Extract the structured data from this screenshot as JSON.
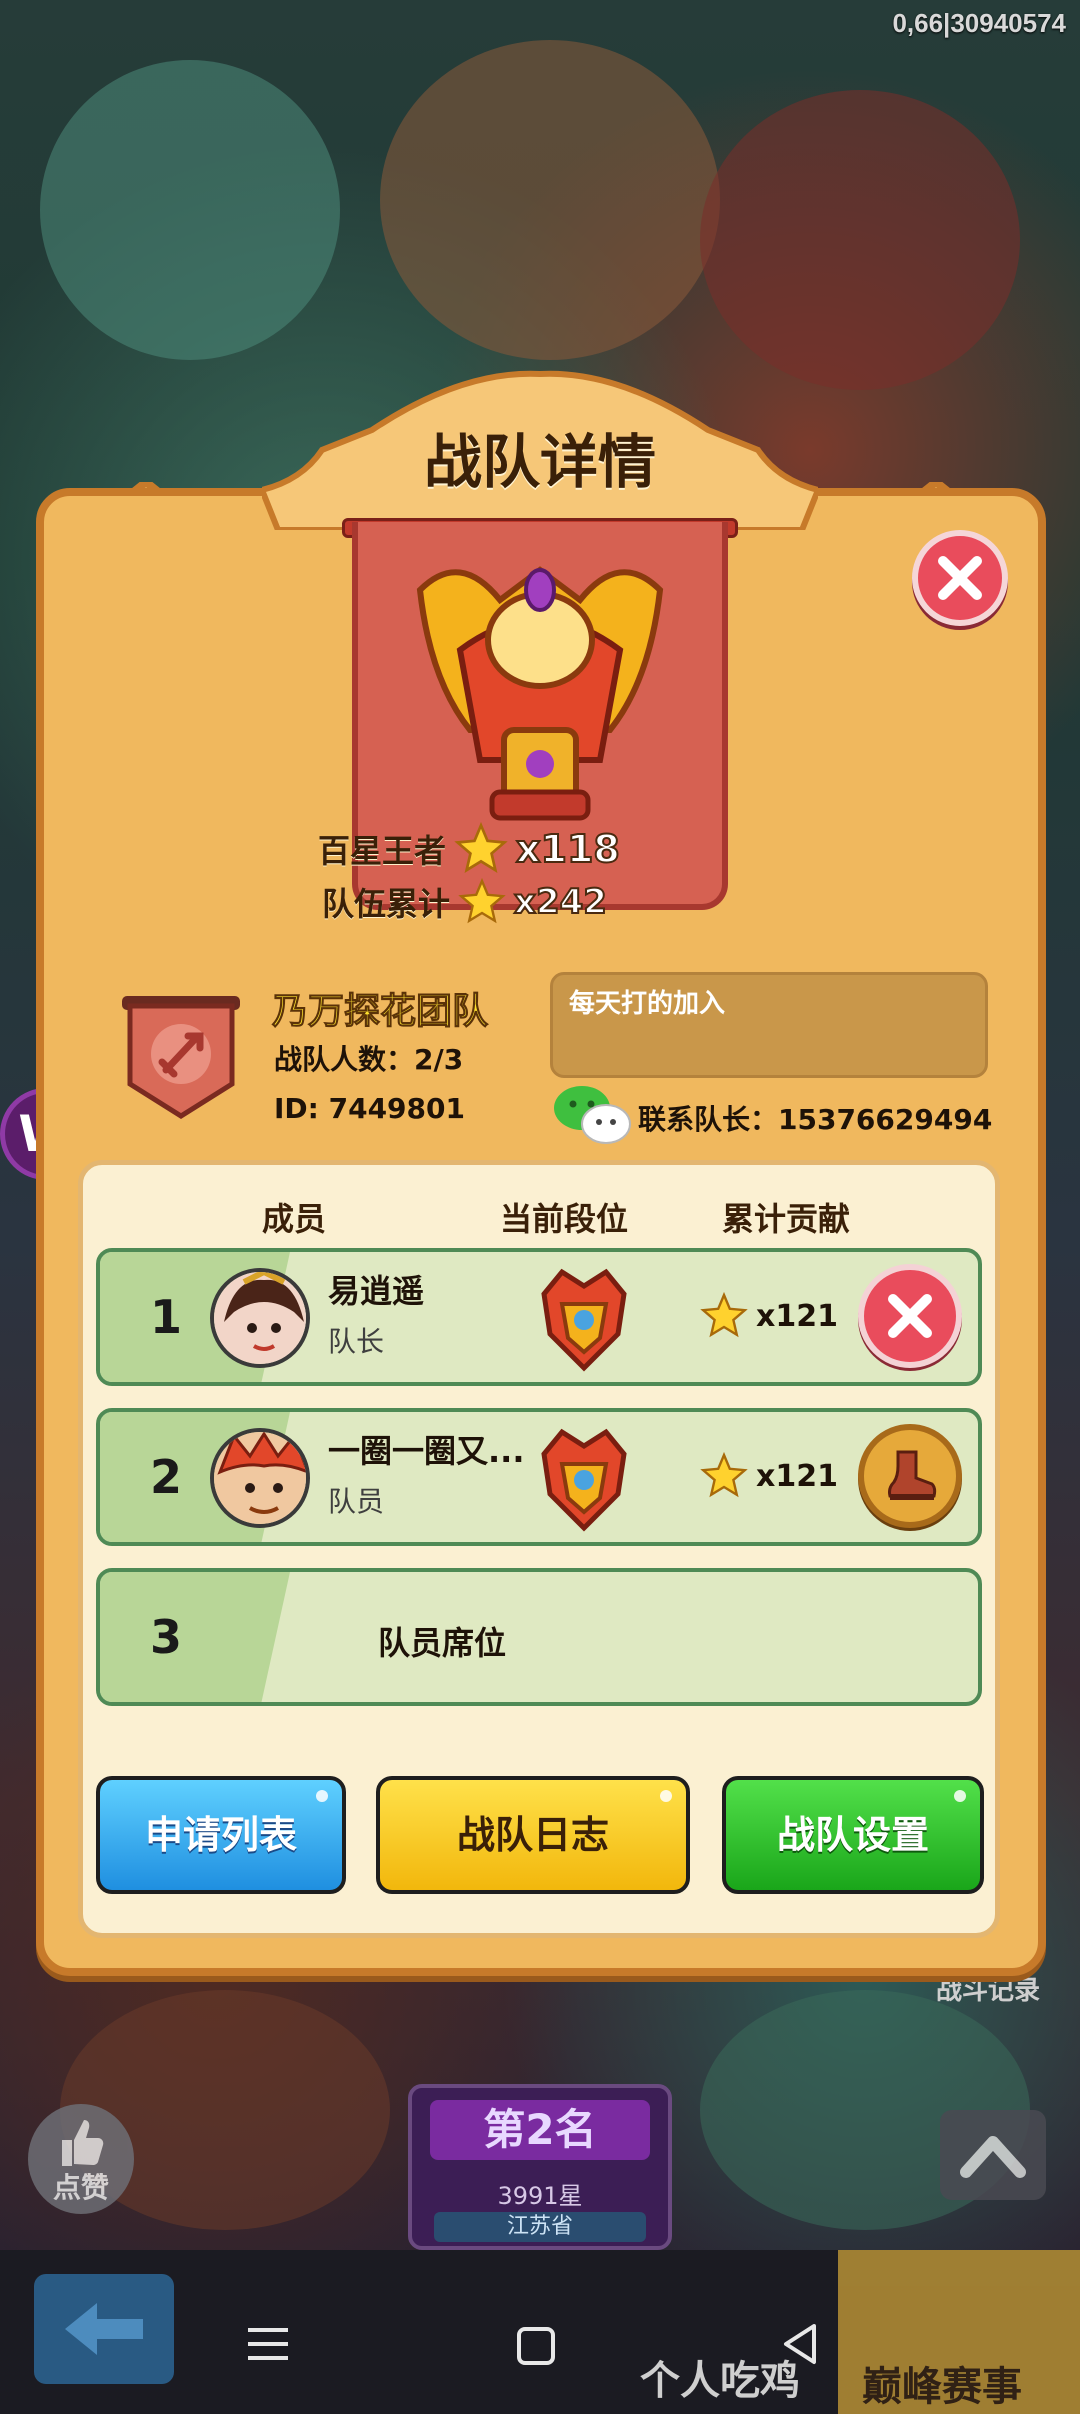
{
  "status": {
    "top_right_id": "0,66|30940574"
  },
  "background": {
    "like_label": "点赞",
    "battle_record": "战斗记录",
    "rank_badge": {
      "title": "第2名",
      "stars": "3991星",
      "province": "江苏省"
    }
  },
  "bottom_tabs": {
    "personal": "个人吃鸡",
    "peak": "巅峰赛事"
  },
  "modal": {
    "title": "战队详情",
    "hundred_star_label": "百星王者",
    "hundred_star_value": "x118",
    "team_total_label": "队伍累计",
    "team_total_value": "x242",
    "team_name": "乃万探花团队",
    "team_count": "战队人数：2/3",
    "team_id": "ID: 7449801",
    "motto": "每天打的加入",
    "contact": "联系队长：15376629494",
    "columns": {
      "member": "成员",
      "rank": "当前段位",
      "contribution": "累计贡献"
    },
    "members": [
      {
        "num": "1",
        "name": "易逍遥",
        "role": "队长",
        "contribution": "x121",
        "action_icon": "close-icon"
      },
      {
        "num": "2",
        "name": "一圈一圈又...",
        "role": "队员",
        "contribution": "x121",
        "action_icon": "boot-icon"
      }
    ],
    "empty_seat": {
      "num": "3",
      "label": "队员席位"
    },
    "buttons": {
      "apply_list": "申请列表",
      "team_log": "战队日志",
      "team_settings": "战队设置"
    }
  },
  "colors": {
    "modal_bg": "#f0b85e",
    "row_bg": "#dfe9c2",
    "team_name": "#ffe22e",
    "btn_blue": "#1f8fe0",
    "btn_yellow": "#f2b70c",
    "btn_green": "#1aa61a",
    "close_red": "#e94c5c"
  }
}
